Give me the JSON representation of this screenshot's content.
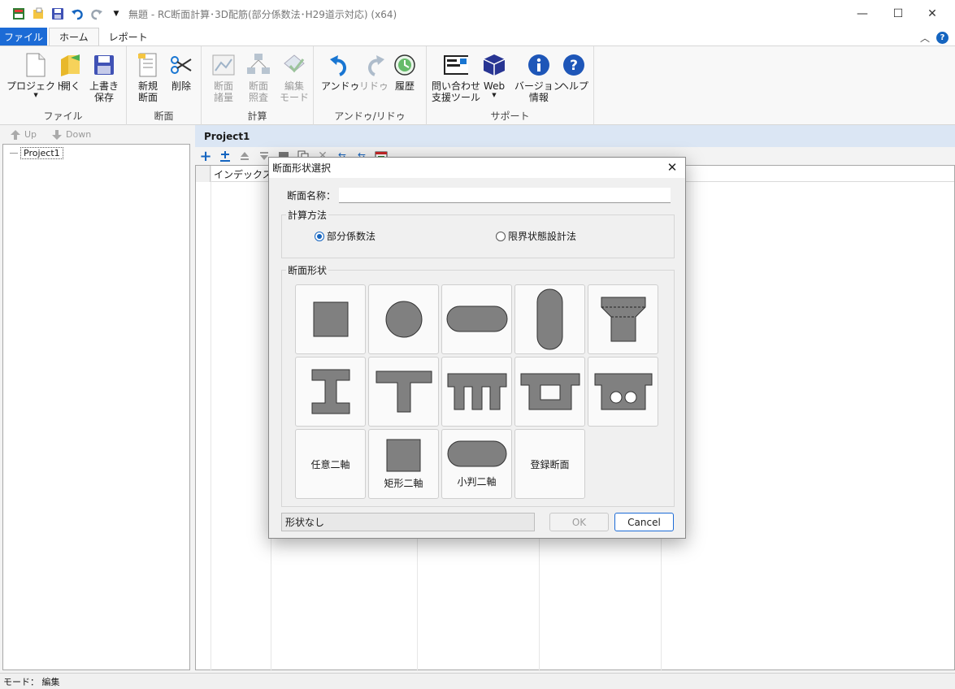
{
  "window": {
    "title": "無題 - RC断面計算･3D配筋(部分係数法･H29道示対応) (x64)",
    "minimize": "—",
    "maximize": "☐",
    "close": "✕"
  },
  "tabs": [
    {
      "label": "ファイル"
    },
    {
      "label": "ホーム"
    },
    {
      "label": "レポート"
    }
  ],
  "ribbon": {
    "collapse": "︿",
    "help_badge": "?",
    "groups": {
      "file": {
        "label": "ファイル",
        "project": "プロジェクト",
        "open": "開く",
        "save": "上書き\n保存"
      },
      "section": {
        "label": "断面",
        "new": "新規\n断面",
        "delete": "削除"
      },
      "calc": {
        "label": "計算",
        "quantities": "断面\n諸量",
        "check": "断面\n照査",
        "edit_mode": "編集\nモード"
      },
      "undo": {
        "label": "アンドゥ/リドゥ",
        "undo": "アンドゥ",
        "redo": "リドゥ",
        "history": "履歴"
      },
      "support": {
        "label": "サポート",
        "contact": "問い合わせ\n支援ツール",
        "web": "Web",
        "version": "バージョン\n情報",
        "help": "ヘルプ"
      }
    }
  },
  "left_pane": {
    "up": "Up",
    "down": "Down",
    "tree_root": "Project1"
  },
  "right_pane": {
    "header": "Project1",
    "grid_col1": "インデックス"
  },
  "statusbar": {
    "text": "モード： 編集"
  },
  "dialog": {
    "title": "断面形状選択",
    "name_label": "断面名称：",
    "name_value": "",
    "method_label": "計算方法",
    "method_options": [
      "部分係数法",
      "限界状態設計法"
    ],
    "method_selected": "部分係数法",
    "shape_label": "断面形状",
    "shapes": [
      {
        "name": "矩形"
      },
      {
        "name": "円形"
      },
      {
        "name": "小判形(横)"
      },
      {
        "name": "小判形(縦)"
      },
      {
        "name": "フーチング形"
      },
      {
        "name": "I形"
      },
      {
        "name": "T形"
      },
      {
        "name": "π形"
      },
      {
        "name": "箱形"
      },
      {
        "name": "中空床版"
      },
      {
        "name": "任意二軸",
        "label": "任意二軸"
      },
      {
        "name": "矩形二軸",
        "label": "矩形二軸"
      },
      {
        "name": "小判二軸",
        "label": "小判二軸"
      },
      {
        "name": "登録断面",
        "label": "登録断面"
      }
    ],
    "status": "形状なし",
    "ok": "OK",
    "cancel": "Cancel",
    "close": "✕"
  }
}
